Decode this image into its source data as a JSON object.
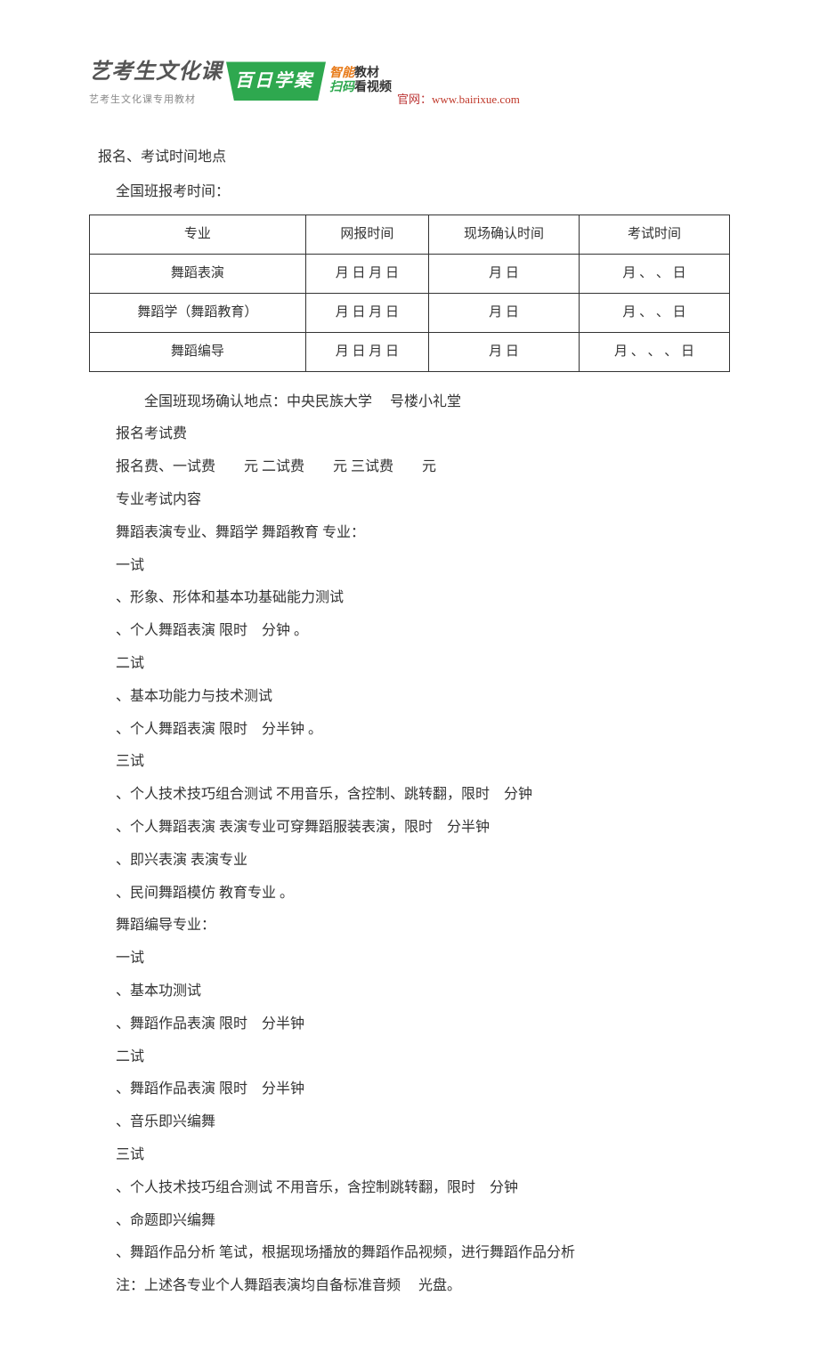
{
  "logo": {
    "left_main": "艺考生文化课",
    "left_sub": "艺考生文化课专用教材",
    "mid": "百日学案",
    "right_top_orange": "智能",
    "right_top_rest": "教材",
    "right_bot_green": "扫码",
    "right_bot_rest": "看视频",
    "site_prefix": "官网：",
    "site_url": "www.bairixue.com"
  },
  "title_line": "报名、考试时间地点",
  "subtitle": "全国班报考时间：",
  "table": {
    "headers": [
      "专业",
      "网报时间",
      "现场确认时间",
      "考试时间"
    ],
    "rows": [
      [
        "舞蹈表演",
        "月   日   月   日",
        "月   日",
        "月  、 、  日"
      ],
      [
        "舞蹈学（舞蹈教育）",
        "月   日   月   日",
        "月   日",
        "月  、 、   日"
      ],
      [
        "舞蹈编导",
        "月   日   月    日",
        "月    日",
        "月  、 、 、  日"
      ]
    ]
  },
  "lines": [
    "　　全国班现场确认地点：中央民族大学　 号楼小礼堂",
    "报名考试费",
    "报名费、一试费　　元 二试费　　元 三试费　　元",
    "专业考试内容",
    "舞蹈表演专业、舞蹈学 舞蹈教育 专业：",
    "一试",
    " 、形象、形体和基本功基础能力测试",
    " 、个人舞蹈表演 限时　分钟 。",
    "二试",
    " 、基本功能力与技术测试",
    " 、个人舞蹈表演 限时　分半钟 。",
    "三试",
    " 、个人技术技巧组合测试 不用音乐，含控制、跳转翻，限时　分钟",
    " 、个人舞蹈表演 表演专业可穿舞蹈服装表演，限时　分半钟",
    " 、即兴表演 表演专业",
    " 、民间舞蹈模仿 教育专业 。",
    "舞蹈编导专业：",
    "一试",
    " 、基本功测试",
    " 、舞蹈作品表演 限时　分半钟",
    "二试",
    " 、舞蹈作品表演 限时　分半钟",
    " 、音乐即兴编舞",
    "三试",
    " 、个人技术技巧组合测试 不用音乐，含控制跳转翻，限时　分钟",
    " 、命题即兴编舞",
    " 、舞蹈作品分析 笔试，根据现场播放的舞蹈作品视频，进行舞蹈作品分析",
    "注：上述各专业个人舞蹈表演均自备标准音频　 光盘。"
  ]
}
